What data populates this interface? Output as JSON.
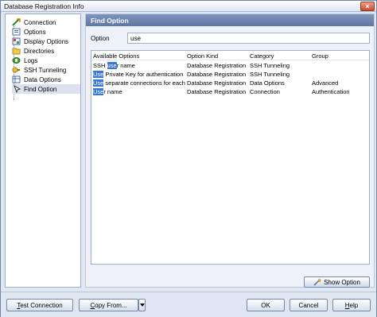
{
  "window": {
    "title": "Database Registration Info",
    "close_glyph": "×"
  },
  "nav": {
    "items": [
      {
        "label": "Connection",
        "icon": "connection-icon"
      },
      {
        "label": "Options",
        "icon": "options-icon"
      },
      {
        "label": "Display Options",
        "icon": "display-options-icon"
      },
      {
        "label": "Directories",
        "icon": "folder-icon"
      },
      {
        "label": "Logs",
        "icon": "logs-icon"
      },
      {
        "label": "SSH Tunneling",
        "icon": "ssh-tunneling-icon"
      },
      {
        "label": "Data Options",
        "icon": "data-options-icon"
      },
      {
        "label": "Find Option",
        "icon": "find-option-icon",
        "selected": true
      }
    ]
  },
  "panel": {
    "header": "Find Option",
    "option_label": "Option",
    "option_value": "use",
    "columns": [
      "Available Options",
      "Option Kind",
      "Category",
      "Group"
    ],
    "rows": [
      {
        "pre": "SSH ",
        "match": "use",
        "post": "r name",
        "kind": "Database Registration In",
        "category": "SSH Tunneling",
        "group": ""
      },
      {
        "pre": "",
        "match": "Use",
        "post": " Private Key for authentication",
        "kind": "Database Registration In",
        "category": "SSH Tunneling",
        "group": ""
      },
      {
        "pre": "",
        "match": "Use",
        "post": " separate connections for each da",
        "kind": "Database Registration In",
        "category": "Data Options",
        "group": "Advanced"
      },
      {
        "pre": "",
        "match": "Use",
        "post": "r name",
        "kind": "Database Registration In",
        "category": "Connection",
        "group": "Authentication"
      }
    ],
    "show_option_label": "Show Option"
  },
  "footer": {
    "test_connection": "Test Connection",
    "copy_from": "Copy From...",
    "ok": "OK",
    "cancel": "Cancel",
    "help": "Help"
  }
}
